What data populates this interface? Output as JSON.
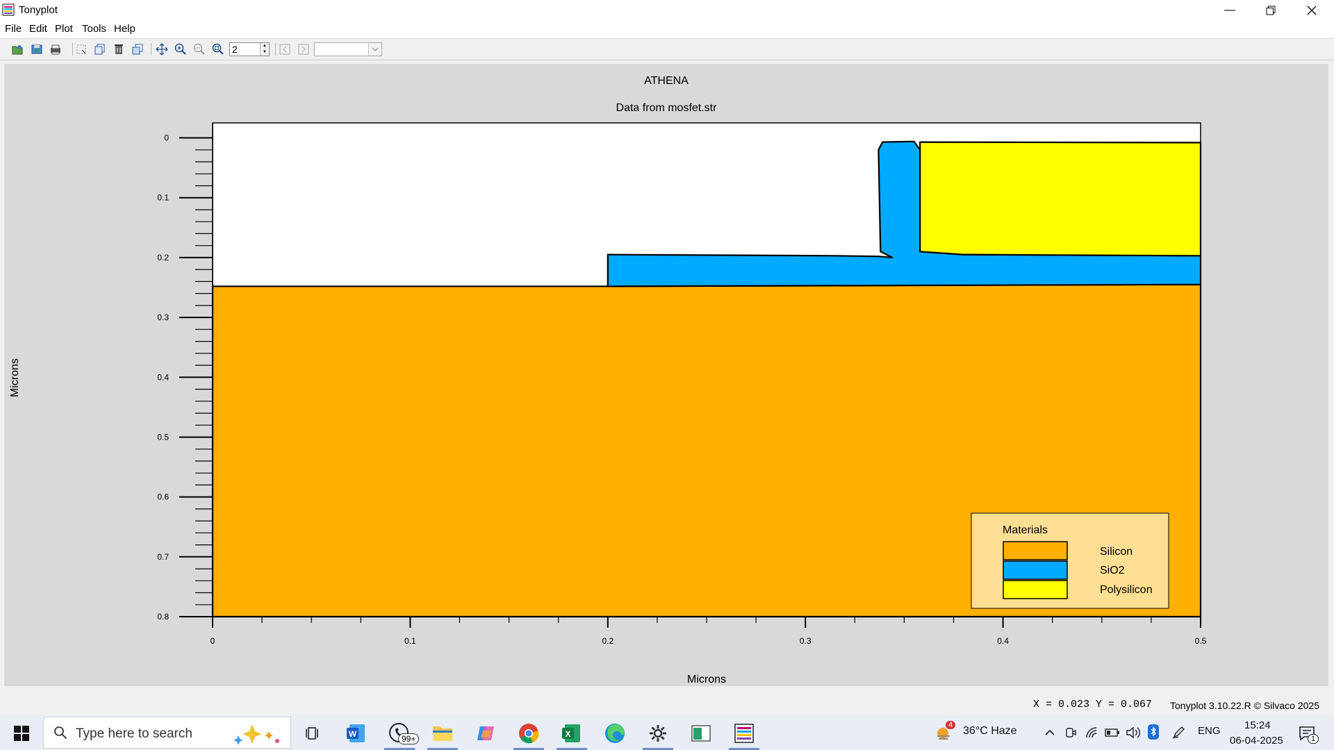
{
  "window": {
    "title": "Tonyplot"
  },
  "menu": [
    "File",
    "Edit",
    "Plot",
    "Tools",
    "Help"
  ],
  "toolbar": {
    "zoom_value": "2",
    "combo_value": ""
  },
  "chart_data": {
    "type": "structure",
    "title": "ATHENA",
    "subtitle": "Data from mosfet.str",
    "xlabel": "Microns",
    "ylabel": "Microns",
    "xlim": [
      0,
      0.5
    ],
    "ylim": [
      0.8,
      -0.025
    ],
    "x_ticks": [
      "0",
      "0.1",
      "0.2",
      "0.3",
      "0.4",
      "0.5"
    ],
    "y_ticks": [
      "0",
      "0.1",
      "0.2",
      "0.3",
      "0.4",
      "0.5",
      "0.6",
      "0.7",
      "0.8"
    ],
    "grid": false,
    "regions": [
      {
        "material": "Silicon",
        "color": "#ffb000",
        "points": [
          [
            0,
            0.248
          ],
          [
            0.2,
            0.248
          ],
          [
            0.5,
            0.245
          ],
          [
            0.5,
            0.8
          ],
          [
            0,
            0.8
          ]
        ]
      },
      {
        "material": "SiO2",
        "color": "#00aaff",
        "points": [
          [
            0.2,
            0.248
          ],
          [
            0.2,
            0.195
          ],
          [
            0.26,
            0.196
          ],
          [
            0.315,
            0.197
          ],
          [
            0.337,
            0.198
          ],
          [
            0.344,
            0.2
          ],
          [
            0.338,
            0.19
          ],
          [
            0.337,
            0.02
          ],
          [
            0.339,
            0.007
          ],
          [
            0.355,
            0.006
          ],
          [
            0.358,
            0.02
          ],
          [
            0.358,
            0.19
          ],
          [
            0.38,
            0.195
          ],
          [
            0.44,
            0.196
          ],
          [
            0.5,
            0.197
          ],
          [
            0.5,
            0.245
          ]
        ]
      },
      {
        "material": "Polysilicon",
        "color": "#ffff00",
        "points": [
          [
            0.358,
            0.007
          ],
          [
            0.5,
            0.008
          ],
          [
            0.5,
            0.197
          ],
          [
            0.44,
            0.196
          ],
          [
            0.38,
            0.195
          ],
          [
            0.358,
            0.19
          ]
        ]
      }
    ],
    "legend": {
      "title": "Materials",
      "position": "bottom-right",
      "entries": [
        {
          "label": "Silicon",
          "color": "#ffb000"
        },
        {
          "label": "SiO2",
          "color": "#00aaff"
        },
        {
          "label": "Polysilicon",
          "color": "#ffff00"
        }
      ]
    }
  },
  "status": {
    "coords": "X = 0.023 Y = 0.067",
    "version": "Tonyplot 3.10.22.R © Silvaco 2025"
  },
  "taskbar": {
    "search_placeholder": "Type here to search",
    "whatsapp_badge": "99+",
    "weather_badge": "4",
    "weather": "36°C  Haze",
    "language": "ENG",
    "time": "15:24",
    "date": "06-04-2025",
    "notif_count": "1"
  }
}
